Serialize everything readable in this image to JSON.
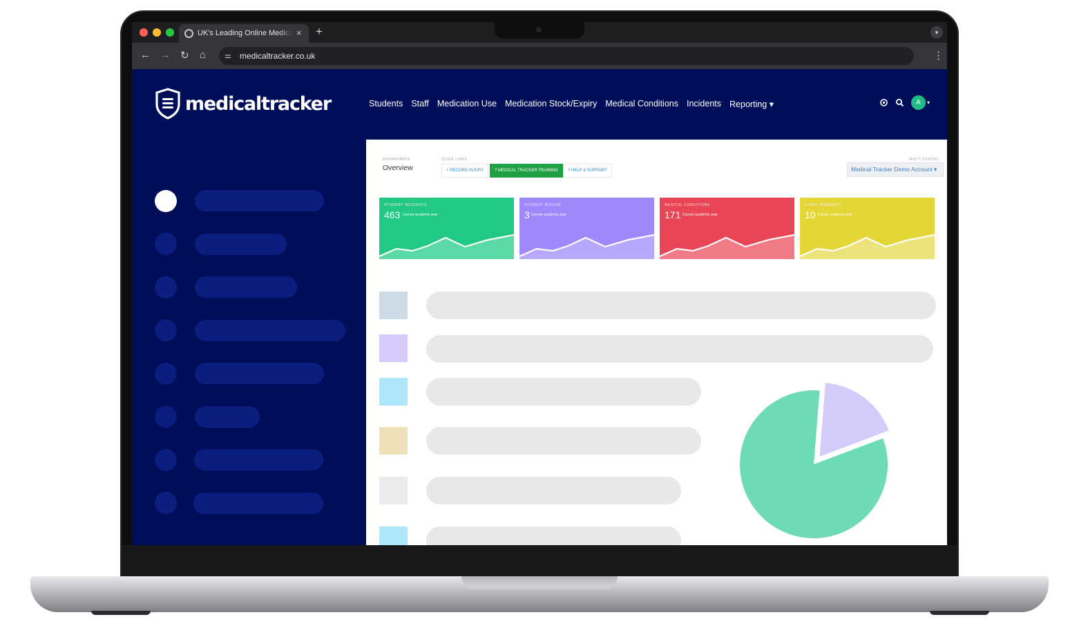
{
  "browser": {
    "tab_title": "UK's Leading Online Medical Tracker",
    "tab_close": "×",
    "new_tab": "+",
    "url": "medicaltracker.co.uk",
    "window_controls": {
      "close": "#ff5f57",
      "minimize": "#febc2e",
      "maximize": "#28c840"
    }
  },
  "header": {
    "brand": "medicaltracker",
    "nav": [
      "Students",
      "Staff",
      "Medication Use",
      "Medication Stock/Expiry",
      "Medical Conditions",
      "Incidents",
      "Reporting"
    ],
    "avatar_initial": "A"
  },
  "dashboard": {
    "dashboards_label": "DASHBOARDS",
    "title": "Overview",
    "quick_links_label": "QUICK LINKS",
    "quick_links": [
      "+ RECORD INJURY",
      "? MEDICAL TRACKER TRAINING",
      "? HELP & SUPPORT"
    ],
    "multi_school_label": "MULTI SCHOOL",
    "account": "Medical Tracker Demo Account"
  },
  "stats": [
    {
      "label": "STUDENT INCIDENTS",
      "value": "463",
      "sub": "Current academic year",
      "color": "#21c985",
      "fill": "#5bd9a4"
    },
    {
      "label": "STUDENT RIDDOR",
      "value": "3",
      "sub": "Current academic year",
      "color": "#9e88fb",
      "fill": "#b8a8fd"
    },
    {
      "label": "MEDICAL CONDITIONS",
      "value": "171",
      "sub": "Current academic year",
      "color": "#e84556",
      "fill": "#f07a86"
    },
    {
      "label": "STAFF INCIDENTS",
      "value": "10",
      "sub": "Current academic year",
      "color": "#e3d636",
      "fill": "#ece37a"
    }
  ],
  "pie": {
    "slices": [
      {
        "color": "#6ddbb4",
        "fraction": 0.82
      },
      {
        "color": "#d4cbfb",
        "fraction": 0.18
      }
    ]
  },
  "skeleton_colors": [
    "#cddbe7",
    "#d6c9fb",
    "#aee6fb",
    "#efe1b7",
    "#ececec",
    "#aee6fb"
  ]
}
